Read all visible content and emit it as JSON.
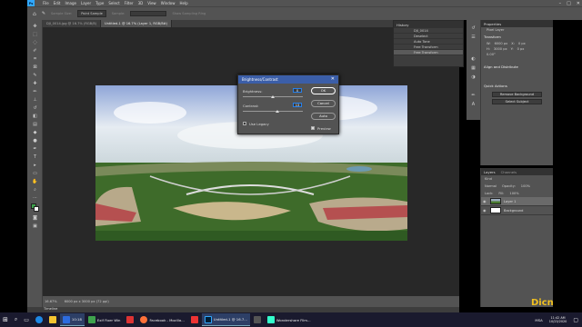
{
  "menu": [
    "File",
    "Edit",
    "Image",
    "Layer",
    "Type",
    "Select",
    "Filter",
    "3D",
    "View",
    "Window",
    "Help"
  ],
  "options_bar": {
    "sample_label": "Sample Size:",
    "sample_value": "Point Sample",
    "sample_label2": "Sample:",
    "hint": "Show Sampling Ring"
  },
  "tabs": [
    {
      "label": "DJI_0014.jpg @ 16.7% (RGB/8)"
    },
    {
      "label": "Untitled-1 @ 16.7% (Layer 1, RGB/8#)"
    }
  ],
  "status": {
    "zoom": "16.67%",
    "doc": "6000 px x 3000 px (72 ppi)"
  },
  "timeline_label": "Timeline",
  "history": {
    "tab": "History",
    "rows": [
      "DJI_0014",
      "Deselect",
      "Auto Tone",
      "Free Transform",
      "Free Transform"
    ]
  },
  "dialog": {
    "title": "Brightness/Contrast",
    "brightness_label": "Brightness:",
    "brightness_value": "0",
    "contrast_label": "Contrast:",
    "contrast_value": "13",
    "use_legacy": "Use Legacy",
    "ok": "OK",
    "cancel": "Cancel",
    "auto": "Auto",
    "preview": "Preview"
  },
  "properties": {
    "tab": "Properties",
    "pixel_layer": "Pixel Layer",
    "transform": "Transform",
    "w_label": "W:",
    "w_value": "6000 px",
    "h_label": "H:",
    "h_value": "3000 px",
    "x_label": "X:",
    "x_value": "0 px",
    "y_label": "Y:",
    "y_value": "0 px",
    "angle": "0.00°",
    "align": "Align and Distribute",
    "quick_actions": "Quick Actions",
    "remove_bg": "Remove Background",
    "select_subject": "Select Subject"
  },
  "layers": {
    "tabs": [
      "Layers",
      "Channels"
    ],
    "kind": "Kind",
    "mode": "Normal",
    "opacity_label": "Opacity:",
    "opacity_value": "100%",
    "lock_label": "Lock:",
    "fill_label": "Fill:",
    "fill_value": "100%",
    "rows": [
      {
        "name": "Layer 1",
        "selected": true
      },
      {
        "name": "Background",
        "selected": false
      }
    ]
  },
  "taskbar": {
    "apps": [
      {
        "label": "10:18",
        "color": "#2d6cdf"
      },
      {
        "label": "Exif Fixer Win",
        "color": "#3fa34d"
      },
      {
        "label": "",
        "color": "#d33"
      },
      {
        "label": "Facebook - Mozilla...",
        "color": "#ff7139"
      },
      {
        "label": "",
        "color": "#e33"
      },
      {
        "label": "Untitled-1 @ 16.7...",
        "color": "#31a8ff"
      },
      {
        "label": "",
        "color": "#555"
      },
      {
        "label": "Wondershare Film...",
        "color": "#3fc"
      }
    ],
    "lang": "MSA",
    "time": "11:42 AM",
    "date": "10/23/2020"
  },
  "watermark": "Dicn"
}
